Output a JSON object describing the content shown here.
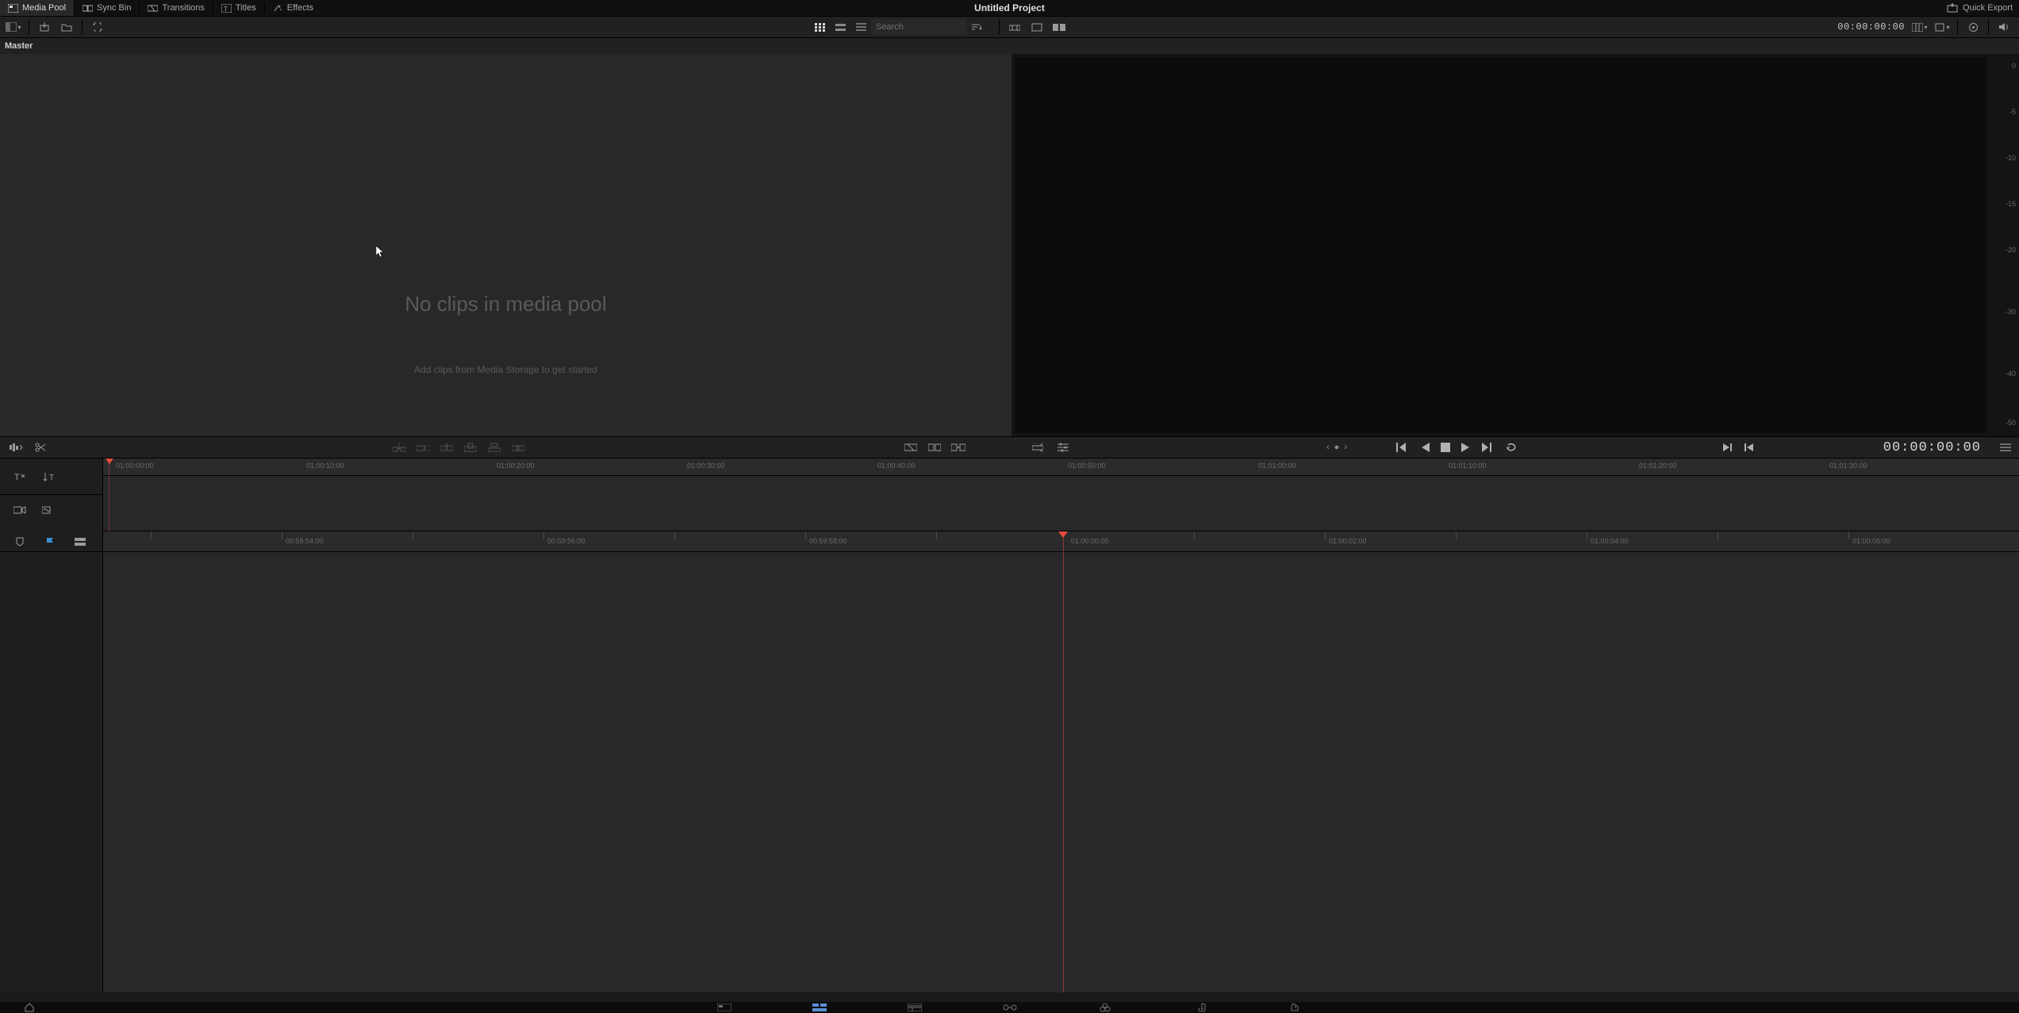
{
  "project_title": "Untitled Project",
  "tabs": {
    "media_pool": "Media Pool",
    "sync_bin": "Sync Bin",
    "transitions": "Transitions",
    "titles": "Titles",
    "effects": "Effects"
  },
  "quick_export": "Quick Export",
  "search_placeholder": "Search",
  "timecode_viewer": "00:00:00:00",
  "breadcrumb": "Master",
  "media_pool_empty": {
    "title": "No clips in media pool",
    "subtitle": "Add clips from Media Storage to get started"
  },
  "meter_ticks": [
    "0",
    "-5",
    "-10",
    "-15",
    "-20",
    "-30",
    "-40",
    "-50"
  ],
  "timecode_transport": "00:00:00:00",
  "overview_ruler": [
    "01:00:00:00",
    "01:00:10:00",
    "01:00:20:00",
    "01:00:30:00",
    "01:00:40:00",
    "01:00:50:00",
    "01:01:00:00",
    "01:01:10:00",
    "01:01:20:00",
    "01:01:30:00"
  ],
  "timeline_ruler": [
    "00:59:54:00",
    "00:59:56:00",
    "00:59:58:00",
    "01:00:00:00",
    "01:00:02:00",
    "01:00:04:00",
    "01:00:06:00"
  ]
}
